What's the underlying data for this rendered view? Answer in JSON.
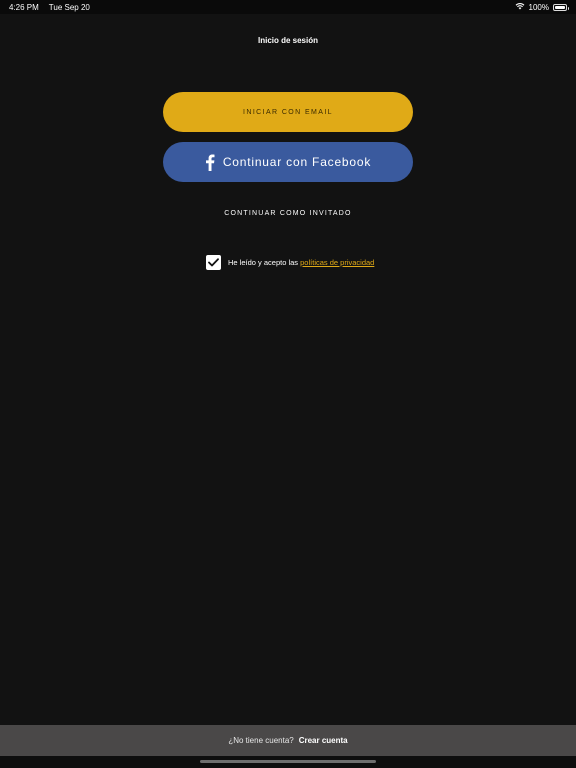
{
  "status_bar": {
    "time": "4:26 PM",
    "date": "Tue Sep 20",
    "battery": "100%",
    "battery_level": 1.0,
    "wifi_icon": "wifi-icon",
    "battery_icon": "battery-icon"
  },
  "nav": {
    "title": "Inicio de sesión"
  },
  "buttons": {
    "email_label": "INICIAR CON EMAIL",
    "facebook_label": "Continuar con Facebook",
    "facebook_icon": "facebook-icon",
    "guest_label": "CONTINUAR COMO INVITADO"
  },
  "consent": {
    "checked": true,
    "text": "He leído y acepto las",
    "link_text": "políticas de privacidad"
  },
  "footer": {
    "question": "¿No tiene cuenta?",
    "create_label": "Crear cuenta"
  },
  "colors": {
    "background": "#121212",
    "accent": "#e0aa17",
    "facebook": "#3a5a9e",
    "footer_bar": "#4a4848"
  }
}
